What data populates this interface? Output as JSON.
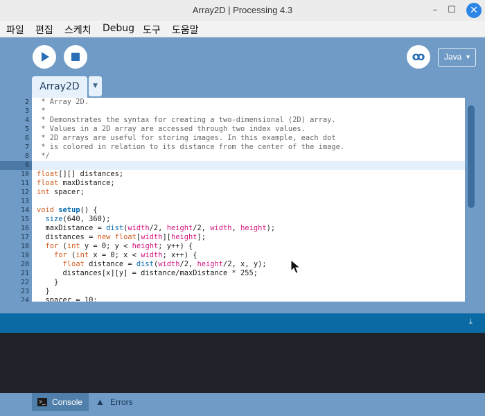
{
  "window": {
    "title": "Array2D | Processing 4.3",
    "minimize": "–",
    "maximize": "☐",
    "close": "✕"
  },
  "menu": [
    "파일",
    "편집",
    "스케치",
    "Debug",
    "도구",
    "도움말"
  ],
  "toolbar": {
    "mode": "Java"
  },
  "tabs": {
    "active": "Array2D",
    "menu_caret": "▼"
  },
  "editor": {
    "lines": [
      {
        "n": "2",
        "parts": [
          {
            "c": "cm",
            "t": " * Array 2D."
          }
        ]
      },
      {
        "n": "3",
        "parts": [
          {
            "c": "cm",
            "t": " *"
          }
        ]
      },
      {
        "n": "4",
        "parts": [
          {
            "c": "cm",
            "t": " * Demonstrates the syntax for creating a two-dimensional (2D) array."
          }
        ]
      },
      {
        "n": "5",
        "parts": [
          {
            "c": "cm",
            "t": " * Values in a 2D array are accessed through two index values."
          }
        ]
      },
      {
        "n": "6",
        "parts": [
          {
            "c": "cm",
            "t": " * 2D arrays are useful for storing images. In this example, each dot"
          }
        ]
      },
      {
        "n": "7",
        "parts": [
          {
            "c": "cm",
            "t": " * is colored in relation to its distance from the center of the image."
          }
        ]
      },
      {
        "n": "8",
        "parts": [
          {
            "c": "cm",
            "t": " */"
          }
        ]
      },
      {
        "n": "9",
        "parts": [
          {
            "c": "txt",
            "t": ""
          }
        ]
      },
      {
        "n": "10",
        "parts": [
          {
            "c": "ty",
            "t": "float"
          },
          {
            "c": "txt",
            "t": "[][] distances;"
          }
        ]
      },
      {
        "n": "11",
        "parts": [
          {
            "c": "ty",
            "t": "float"
          },
          {
            "c": "txt",
            "t": " maxDistance;"
          }
        ]
      },
      {
        "n": "12",
        "parts": [
          {
            "c": "ty",
            "t": "int"
          },
          {
            "c": "txt",
            "t": " spacer;"
          }
        ]
      },
      {
        "n": "13",
        "parts": [
          {
            "c": "txt",
            "t": ""
          }
        ]
      },
      {
        "n": "14",
        "parts": [
          {
            "c": "ty",
            "t": "void"
          },
          {
            "c": "txt",
            "t": " "
          },
          {
            "c": "bold",
            "t": "setup"
          },
          {
            "c": "txt",
            "t": "() {"
          }
        ]
      },
      {
        "n": "15",
        "parts": [
          {
            "c": "txt",
            "t": "  "
          },
          {
            "c": "fn",
            "t": "size"
          },
          {
            "c": "txt",
            "t": "(640, 360);"
          }
        ]
      },
      {
        "n": "16",
        "parts": [
          {
            "c": "txt",
            "t": "  maxDistance = "
          },
          {
            "c": "fn",
            "t": "dist"
          },
          {
            "c": "txt",
            "t": "("
          },
          {
            "c": "env",
            "t": "width"
          },
          {
            "c": "txt",
            "t": "/2, "
          },
          {
            "c": "env",
            "t": "height"
          },
          {
            "c": "txt",
            "t": "/2, "
          },
          {
            "c": "env",
            "t": "width"
          },
          {
            "c": "txt",
            "t": ", "
          },
          {
            "c": "env",
            "t": "height"
          },
          {
            "c": "txt",
            "t": ");"
          }
        ]
      },
      {
        "n": "17",
        "parts": [
          {
            "c": "txt",
            "t": "  distances = "
          },
          {
            "c": "kw",
            "t": "new"
          },
          {
            "c": "txt",
            "t": " "
          },
          {
            "c": "ty",
            "t": "float"
          },
          {
            "c": "txt",
            "t": "["
          },
          {
            "c": "env",
            "t": "width"
          },
          {
            "c": "txt",
            "t": "]["
          },
          {
            "c": "env",
            "t": "height"
          },
          {
            "c": "txt",
            "t": "];"
          }
        ]
      },
      {
        "n": "18",
        "parts": [
          {
            "c": "txt",
            "t": "  "
          },
          {
            "c": "kw",
            "t": "for"
          },
          {
            "c": "txt",
            "t": " ("
          },
          {
            "c": "ty",
            "t": "int"
          },
          {
            "c": "txt",
            "t": " y = 0; y < "
          },
          {
            "c": "env",
            "t": "height"
          },
          {
            "c": "txt",
            "t": "; y++) {"
          }
        ]
      },
      {
        "n": "19",
        "parts": [
          {
            "c": "txt",
            "t": "    "
          },
          {
            "c": "kw",
            "t": "for"
          },
          {
            "c": "txt",
            "t": " ("
          },
          {
            "c": "ty",
            "t": "int"
          },
          {
            "c": "txt",
            "t": " x = 0; x < "
          },
          {
            "c": "env",
            "t": "width"
          },
          {
            "c": "txt",
            "t": "; x++) {"
          }
        ]
      },
      {
        "n": "20",
        "parts": [
          {
            "c": "txt",
            "t": "      "
          },
          {
            "c": "ty",
            "t": "float"
          },
          {
            "c": "txt",
            "t": " distance = "
          },
          {
            "c": "fn",
            "t": "dist"
          },
          {
            "c": "txt",
            "t": "("
          },
          {
            "c": "env",
            "t": "width"
          },
          {
            "c": "txt",
            "t": "/2, "
          },
          {
            "c": "env",
            "t": "height"
          },
          {
            "c": "txt",
            "t": "/2, x, y);"
          }
        ]
      },
      {
        "n": "21",
        "parts": [
          {
            "c": "txt",
            "t": "      distances[x][y] = distance/maxDistance * 255;"
          }
        ]
      },
      {
        "n": "22",
        "parts": [
          {
            "c": "txt",
            "t": "    }"
          }
        ]
      },
      {
        "n": "23",
        "parts": [
          {
            "c": "txt",
            "t": "  }"
          }
        ]
      },
      {
        "n": "24",
        "parts": [
          {
            "c": "txt",
            "t": "  spacer = 10;"
          }
        ]
      }
    ]
  },
  "bottom_tabs": {
    "console": "Console",
    "errors": "Errors"
  }
}
